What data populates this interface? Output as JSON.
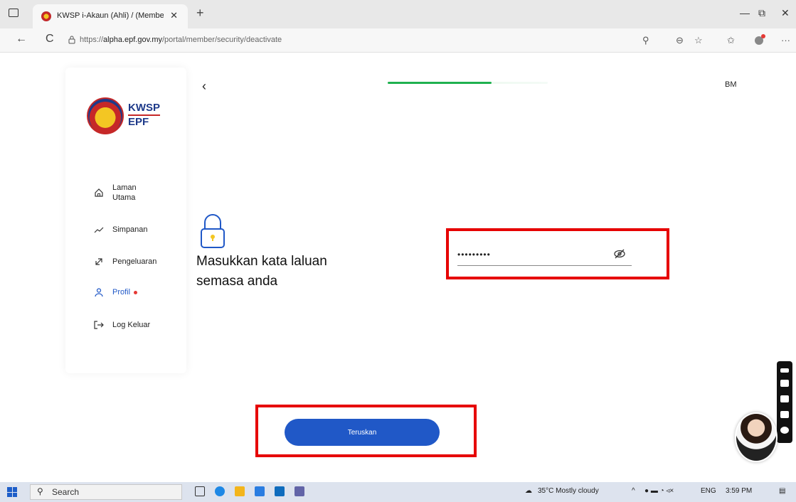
{
  "browser": {
    "tab_title": "KWSP i-Akaun (Ahli) / (Member) ·",
    "tab_close": "✕",
    "new_tab": "+",
    "url_prefix": "https://",
    "url_host": "alpha.epf.gov.my",
    "url_path": "/portal/member/security/deactivate",
    "back": "←",
    "refresh": "C",
    "minimize": "—",
    "restore": "⧉",
    "close": "✕",
    "more": "···"
  },
  "logo": {
    "line1": "KWSP",
    "line2": "EPF"
  },
  "sidebar": {
    "items": [
      {
        "label": "Laman\nUtama",
        "icon": "home-icon"
      },
      {
        "label": "Simpanan",
        "icon": "trend-icon"
      },
      {
        "label": "Pengeluaran",
        "icon": "withdraw-icon"
      },
      {
        "label": "Profil",
        "icon": "user-icon",
        "active": true
      },
      {
        "label": "Log Keluar",
        "icon": "logout-icon"
      }
    ]
  },
  "header": {
    "back": "‹",
    "language": "BM",
    "progress": 0.65
  },
  "form": {
    "heading": "Masukkan kata laluan semasa anda",
    "password_masked": "•••••••••",
    "submit_label": "Teruskan"
  },
  "taskbar": {
    "search_placeholder": "Search",
    "weather": "35°C  Mostly cloudy",
    "language": "ENG",
    "time": "3:59 PM"
  },
  "colors": {
    "primary": "#2058c7",
    "highlight": "#e60000",
    "progress": "#1fb14f"
  }
}
